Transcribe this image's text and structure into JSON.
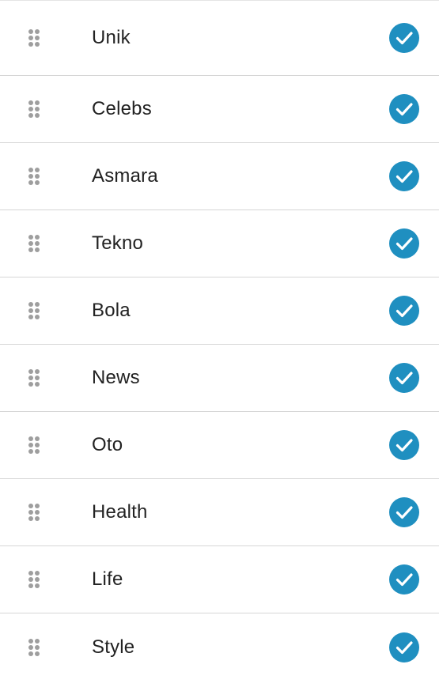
{
  "colors": {
    "accent": "#1f8fc0",
    "handle": "#9e9e9e",
    "divider": "#d6d6d6",
    "text": "#222222"
  },
  "icons": {
    "handle": "drag-handle-icon",
    "check": "check-circle-icon"
  },
  "categories": [
    {
      "label": "Unik",
      "checked": true
    },
    {
      "label": "Celebs",
      "checked": true
    },
    {
      "label": "Asmara",
      "checked": true
    },
    {
      "label": "Tekno",
      "checked": true
    },
    {
      "label": "Bola",
      "checked": true
    },
    {
      "label": "News",
      "checked": true
    },
    {
      "label": "Oto",
      "checked": true
    },
    {
      "label": "Health",
      "checked": true
    },
    {
      "label": "Life",
      "checked": true
    },
    {
      "label": "Style",
      "checked": true
    }
  ]
}
